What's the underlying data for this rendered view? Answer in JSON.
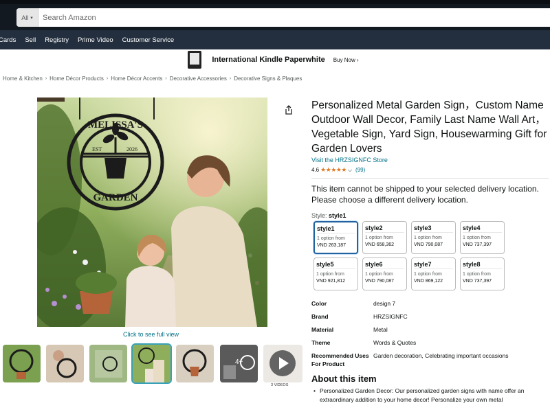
{
  "header": {
    "search": {
      "category": "All",
      "placeholder": "Search Amazon"
    }
  },
  "nav": {
    "items": [
      "Cards",
      "Sell",
      "Registry",
      "Prime Video",
      "Customer Service"
    ]
  },
  "promo": {
    "title": "International Kindle Paperwhite",
    "cta": "Buy Now ›"
  },
  "breadcrumbs": [
    "Home & Kitchen",
    "Home Décor Products",
    "Home Décor Accents",
    "Decorative Accessories",
    "Decorative Signs & Plaques"
  ],
  "gallery": {
    "click_full_view": "Click to see full view",
    "sign_top_text": "MELISSA'S",
    "sign_est": "EST",
    "sign_year": "2026",
    "sign_bottom_text": "GARDEN",
    "thumb_more": "4+",
    "videos_label": "3 VIDEOS"
  },
  "product": {
    "title": "Personalized Metal Garden Sign，Custom Name Outdoor Wall Decor, Family Last Name Wall Art，Vegetable Sign, Yard Sign, Housewarming Gift for Garden Lovers",
    "store": "Visit the HRZSIGNFC Store",
    "rating_value": "4.6",
    "rating_stars": "★★★★★",
    "rating_caret": "⌵",
    "rating_count": "(99)",
    "shipping_notice": "This item cannot be shipped to your selected delivery location. Please choose a different delivery location.",
    "style_label": "Style:",
    "style_selected": "style1",
    "styles": [
      {
        "name": "style1",
        "line": "1 option from",
        "price": "VND 263,187"
      },
      {
        "name": "style2",
        "line": "1 option from",
        "price": "VND 658,362"
      },
      {
        "name": "style3",
        "line": "1 option from",
        "price": "VND 790,087"
      },
      {
        "name": "style4",
        "line": "1 option from",
        "price": "VND 737,397"
      },
      {
        "name": "style5",
        "line": "1 option from",
        "price": "VND 921,812"
      },
      {
        "name": "style6",
        "line": "1 option from",
        "price": "VND 790,087"
      },
      {
        "name": "style7",
        "line": "1 option from",
        "price": "VND 869,122"
      },
      {
        "name": "style8",
        "line": "1 option from",
        "price": "VND 737,397"
      }
    ],
    "details": [
      {
        "k": "Color",
        "v": "design 7"
      },
      {
        "k": "Brand",
        "v": "HRZSIGNFC"
      },
      {
        "k": "Material",
        "v": "Metal"
      },
      {
        "k": "Theme",
        "v": "Words & Quotes"
      },
      {
        "k": "Recommended Uses For Product",
        "v": "Garden decoration, Celebrating important occasions"
      }
    ],
    "about_title": "About this item",
    "about_bullet": "Personalized Garden Decor: Our personalized garden signs with name offer an extraordinary addition to your home decor! Personalize your own metal"
  },
  "colors": {
    "link": "#007185",
    "star": "#de7921",
    "header": "#131921",
    "nav": "#232f3e",
    "selected_border": "#2162a1"
  }
}
